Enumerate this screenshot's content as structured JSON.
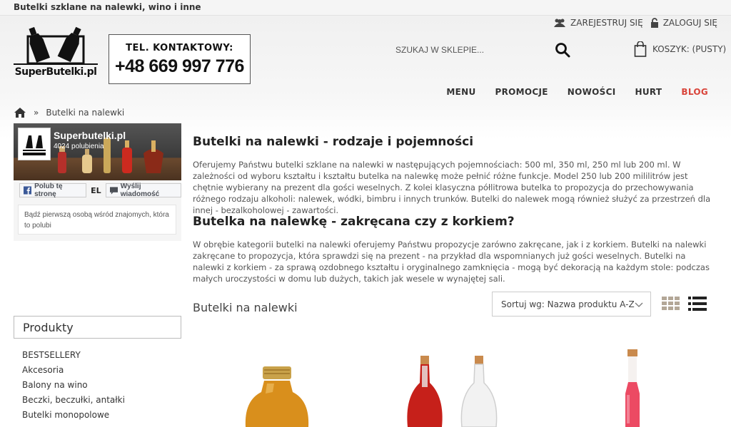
{
  "topbar": {
    "tagline": "Butelki szklane na nalewki, wino i inne"
  },
  "logo": {
    "text": "SuperButelki.pl"
  },
  "contact": {
    "label": "TEL. KONTAKTOWY:",
    "phone": "+48 669 997 776"
  },
  "account": {
    "register": "ZAREJESTRUJ SIĘ",
    "login": "ZALOGUJ SIĘ"
  },
  "search": {
    "placeholder": "SZUKAJ W SKLEPIE..."
  },
  "cart": {
    "label": "KOSZYK: (PUSTY)"
  },
  "nav": {
    "items": [
      "MENU",
      "PROMOCJE",
      "NOWOŚCI",
      "HURT",
      "BLOG"
    ]
  },
  "breadcrumb": {
    "separator": "»",
    "current": "Butelki na nalewki"
  },
  "facebook": {
    "page_name": "Superbutelki.pl",
    "likes": "4024 polubienia",
    "like_button": "Polub tę stronę",
    "el_text": "EL",
    "message_button": "Wyślij wiadomość",
    "friends_text": "Bądź pierwszą osobą wśród znajomych, która to polubi"
  },
  "sidebar": {
    "title": "Produkty",
    "categories": [
      "BESTSELLERY",
      "Akcesoria",
      "Balony na wino",
      "Beczki, beczułki, antałki",
      "Butelki monopolowe"
    ]
  },
  "content": {
    "heading1": "Butelki na nalewki - rodzaje i pojemności",
    "para1": "Oferujemy Państwu butelki szklane na nalewki w następujących pojemnościach: 500 ml, 350 ml, 250 ml lub 200 ml. W zależności od wyboru kształtu i kształtu butelka na nalewkę może pełnić różne funkcje. Model 250 lub 200 mililitrów jest chętnie wybierany na prezent dla gości weselnych. Z kolei klasyczna półlitrowa butelka to propozycja do przechowywania różnego rodzaju alkoholi: nalewek, wódki, bimbru i innych trunków. Butelki do nalewek mogą również służyć za przestrzeń dla innej - bezalkoholowej - zawartości.",
    "heading2": "Butelka na nalewkę - zakręcana czy z korkiem?",
    "para2": "W obrębie kategorii butelki na nalewki oferujemy Państwu propozycje zarówno zakręcane, jak i z korkiem. Butelki na nalewki zakręcane to propozycja, która sprawdzi się na prezent - na przykład dla wspomnianych już gości weselnych. Butelki na nalewki z korkiem - za sprawą ozdobnego kształtu i oryginalnego zamknięcia - mogą być dekoracją na każdym stole: podczas małych uroczystości w domu lub dużych, takich jak wesele w wynajętej sali."
  },
  "listing": {
    "title": "Butelki na nalewki",
    "sort_label": "Sortuj wg: Nazwa produktu A-Z"
  },
  "icons": {
    "home": "home-icon",
    "users": "users-icon",
    "lock": "lock-icon",
    "search": "search-icon",
    "bag": "shopping-bag-icon",
    "grid": "grid-view-icon",
    "list": "list-view-icon",
    "chevron": "chevron-down-icon",
    "fb": "facebook-icon",
    "message": "message-icon"
  },
  "colors": {
    "accent_blog": "#d9443a",
    "fb_blue": "#3b5998",
    "grid_icon": "#b3a797",
    "list_icon": "#222222"
  }
}
